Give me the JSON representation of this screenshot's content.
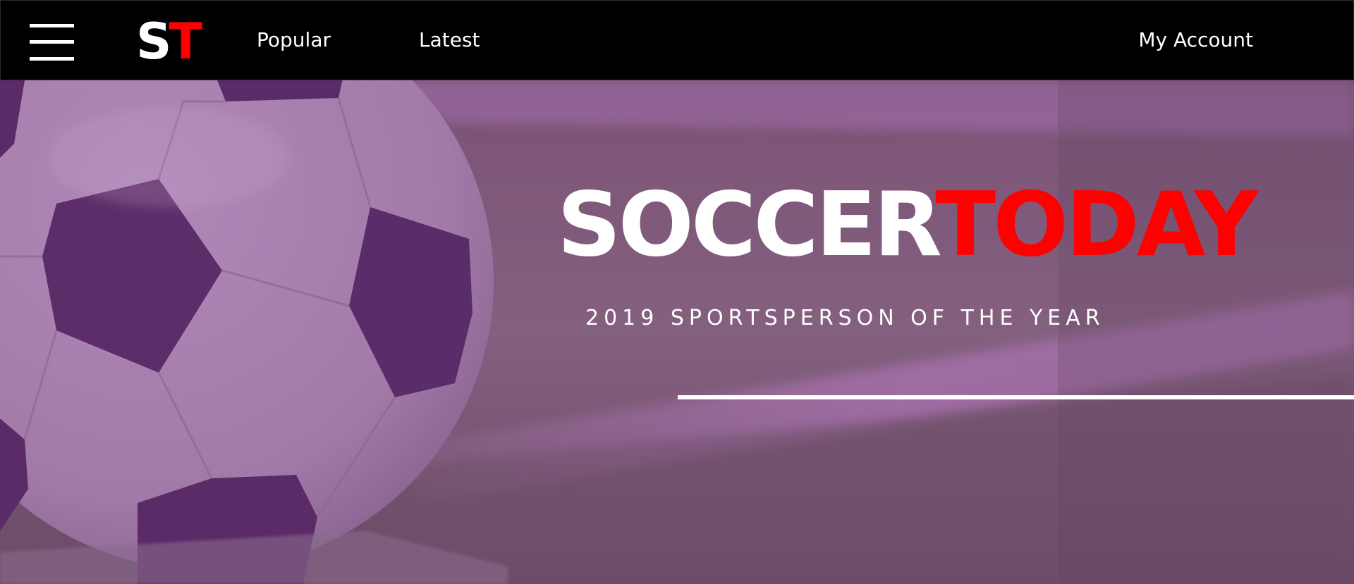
{
  "header": {
    "menu_icon": "hamburger-menu-icon",
    "logo": {
      "first": "S",
      "second": "T"
    },
    "nav": [
      {
        "label": "Popular"
      },
      {
        "label": "Latest"
      }
    ],
    "account_label": "My Account"
  },
  "hero": {
    "title_part1": "SOCCER",
    "title_part2": "TODAY",
    "subtitle": "2019 SPORTSPERSON OF THE YEAR",
    "background_icon": "soccer-ball-image"
  },
  "colors": {
    "nav_background": "#000000",
    "accent_red": "#ff0000",
    "hero_tint": "#8a5a93",
    "text_white": "#ffffff"
  }
}
